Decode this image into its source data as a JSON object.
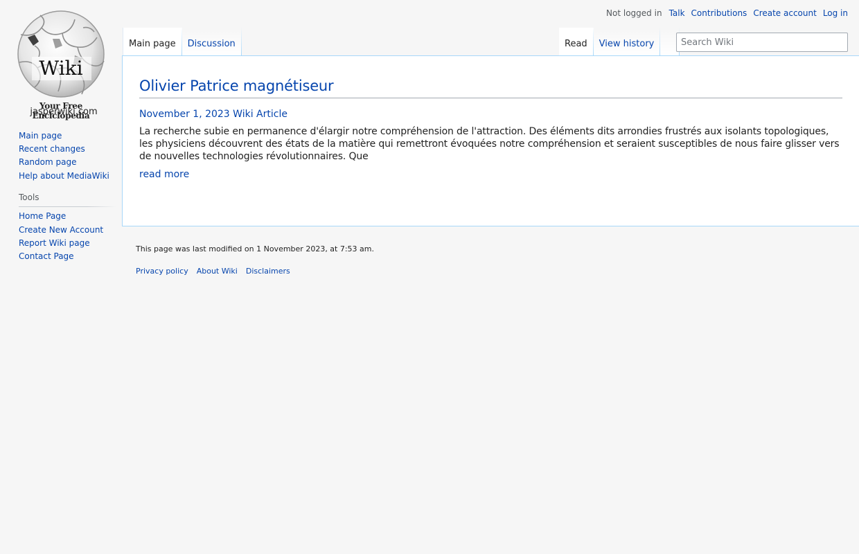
{
  "personal": {
    "anon_label": "Not logged in",
    "items": [
      "Talk",
      "Contributions",
      "Create account",
      "Log in"
    ]
  },
  "logo": {
    "caption": "Your Free Enciclopedia",
    "word": "Wiki",
    "domain": "jasperwiki.com"
  },
  "sidebar": {
    "navigation": [
      "Main page",
      "Recent changes",
      "Random page",
      "Help about MediaWiki"
    ],
    "tools_heading": "Tools",
    "tools": [
      "Home Page",
      "Create New Account",
      "Report Wiki page",
      "Contact Page"
    ]
  },
  "tabs": {
    "left": [
      "Main page",
      "Discussion"
    ],
    "right": [
      "Read",
      "View history"
    ]
  },
  "search": {
    "placeholder": "Search Wiki"
  },
  "article": {
    "title": "Olivier Patrice magnétiseur",
    "date": "November 1, 2023",
    "category": "Wiki Article",
    "excerpt": "La recherche subie en permanence d'élargir notre compréhension de l'attraction. Des éléments dits arrondies frustrés aux isolants topologiques, les physiciens découvrent des états de la matière qui remettront évoquées notre compréhension et seraient susceptibles de nous faire glisser vers de nouvelles technologies révolutionnaires. Que",
    "read_more": "read more"
  },
  "footer": {
    "last_modified": "This page was last modified on 1 November 2023, at 7:53 am.",
    "places": [
      "Privacy policy",
      "About Wiki",
      "Disclaimers"
    ]
  },
  "colors": {
    "link": "#0645ad",
    "text": "#222222",
    "muted": "#54595d",
    "page_bg": "#f6f6f6",
    "content_border": "#a7d7f9"
  }
}
